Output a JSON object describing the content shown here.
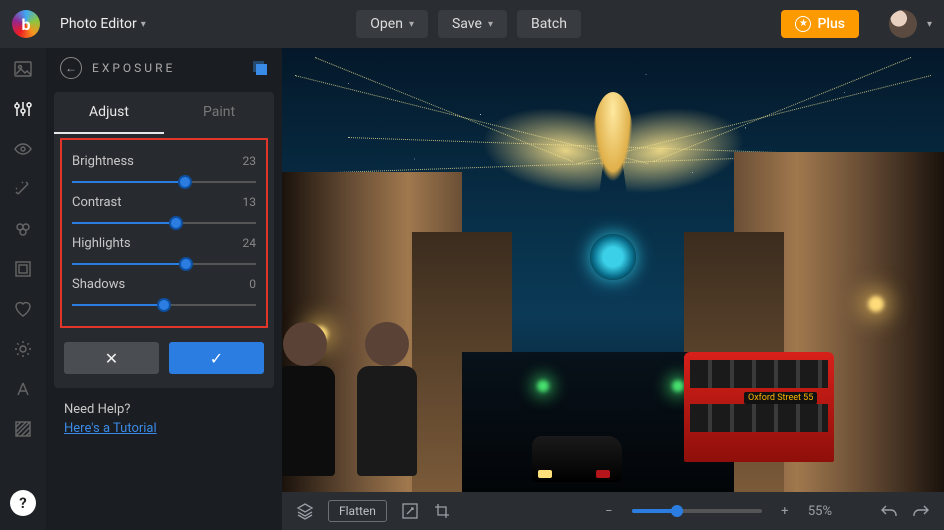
{
  "topbar": {
    "app_menu": "Photo Editor",
    "open": "Open",
    "save": "Save",
    "batch": "Batch",
    "plus": "Plus"
  },
  "panel": {
    "title": "EXPOSURE",
    "tabs": {
      "adjust": "Adjust",
      "paint": "Paint"
    },
    "active_tab": "adjust",
    "sliders": [
      {
        "key": "brightness",
        "label": "Brightness",
        "value": 23,
        "min": -100,
        "max": 100
      },
      {
        "key": "contrast",
        "label": "Contrast",
        "value": 13,
        "min": -100,
        "max": 100
      },
      {
        "key": "highlights",
        "label": "Highlights",
        "value": 24,
        "min": -100,
        "max": 100
      },
      {
        "key": "shadows",
        "label": "Shadows",
        "value": 0,
        "min": -100,
        "max": 100
      }
    ],
    "help_q": "Need Help?",
    "help_link": "Here's a Tutorial"
  },
  "bottombar": {
    "flatten": "Flatten",
    "zoom_pct": 55,
    "zoom_label": "55%"
  },
  "image": {
    "bus_sign": "Oxford Street 55"
  }
}
